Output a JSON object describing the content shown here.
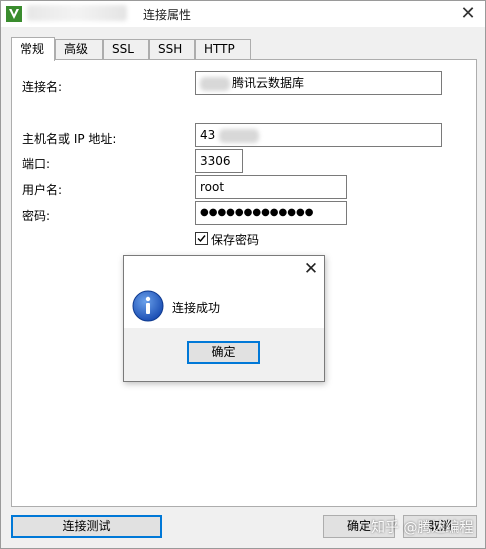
{
  "window": {
    "title": "连接属性",
    "close_glyph": "✕",
    "accent_color": "#0078d7"
  },
  "tabs": [
    {
      "label": "常规",
      "active": true
    },
    {
      "label": "高级"
    },
    {
      "label": "SSL"
    },
    {
      "label": "SSH"
    },
    {
      "label": "HTTP"
    }
  ],
  "form": {
    "connection_name_label": "连接名:",
    "connection_name_value": "腾讯云数据库",
    "host_label": "主机名或 IP 地址:",
    "host_value": "43",
    "port_label": "端口:",
    "port_value": "3306",
    "user_label": "用户名:",
    "user_value": "root",
    "password_label": "密码:",
    "password_value": "●●●●●●●●●●●●●",
    "save_password_label": "保存密码",
    "save_password_checked": true
  },
  "dialog": {
    "close_glyph": "✕",
    "icon": "info-icon",
    "message": "连接成功",
    "ok_label": "确定"
  },
  "footer": {
    "test_button_label": "连接测试",
    "ok_button_label": "确定",
    "cancel_button_label": "取消"
  },
  "watermark": "知乎 @腾达编程"
}
